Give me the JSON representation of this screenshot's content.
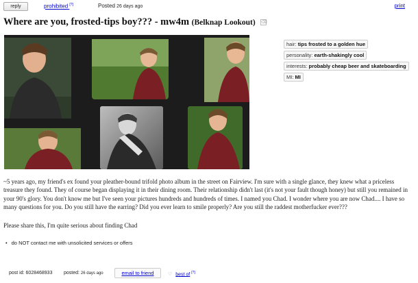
{
  "topbar": {
    "reply_label": "reply",
    "prohibited_label": "prohibited",
    "prohibited_sup": "[?]",
    "posted_label": "Posted",
    "posted_ago": "26 days ago",
    "print_label": "print"
  },
  "posting": {
    "title": "Where are you, frosted-tips boy??? - mw4m",
    "location": "(Belknap Lookout)",
    "trash_glyph": "⌫"
  },
  "photo": {
    "icon": "photo-album-image",
    "colors": {
      "frame": "#141414",
      "shirt_red": "#7a1f23",
      "shirt_dark": "#2b2b2b",
      "grass": "#4f7a2f"
    }
  },
  "attributes": [
    {
      "label": "hair:",
      "value": "tips frosted to a golden hue"
    },
    {
      "label": "personality:",
      "value": "earth-shakingly cool"
    },
    {
      "label": "interests:",
      "value": "probably cheap beer and skateboarding"
    },
    {
      "label": "MI:",
      "value": "MI"
    }
  ],
  "body": {
    "main_text": "~5 years ago, my friend's ex found your pleather-bound trifold photo album in the street on Fairview. I'm sure with a single glance, they knew what a priceless treasure they found. They of course began displaying it in their dining room. Their relationship didn't last (it's not your fault though honey) but still you remained in your 90's glory. You don't know me but I've seen your pictures hundreds and hundreds of times. I named you Chad. I wonder where you are now Chad.... I have so many questions for you. Do you still have the earring? Did you ever learn to smile properly? Are you still the raddest motherfucker ever???",
    "share_text": "Please share this, I'm quite serious about finding Chad"
  },
  "notices": [
    "do NOT contact me with unsolicited services or offers"
  ],
  "footer": {
    "post_id_label": "post id:",
    "post_id": "6028468933",
    "posted_label": "posted:",
    "posted_ago": "26 days ago",
    "email_label": "email to friend",
    "best_of_heart": "♡",
    "best_of_label": "best of",
    "best_of_sup": "[?]"
  },
  "colors": {
    "link": "#0000cc",
    "text": "#222222"
  }
}
